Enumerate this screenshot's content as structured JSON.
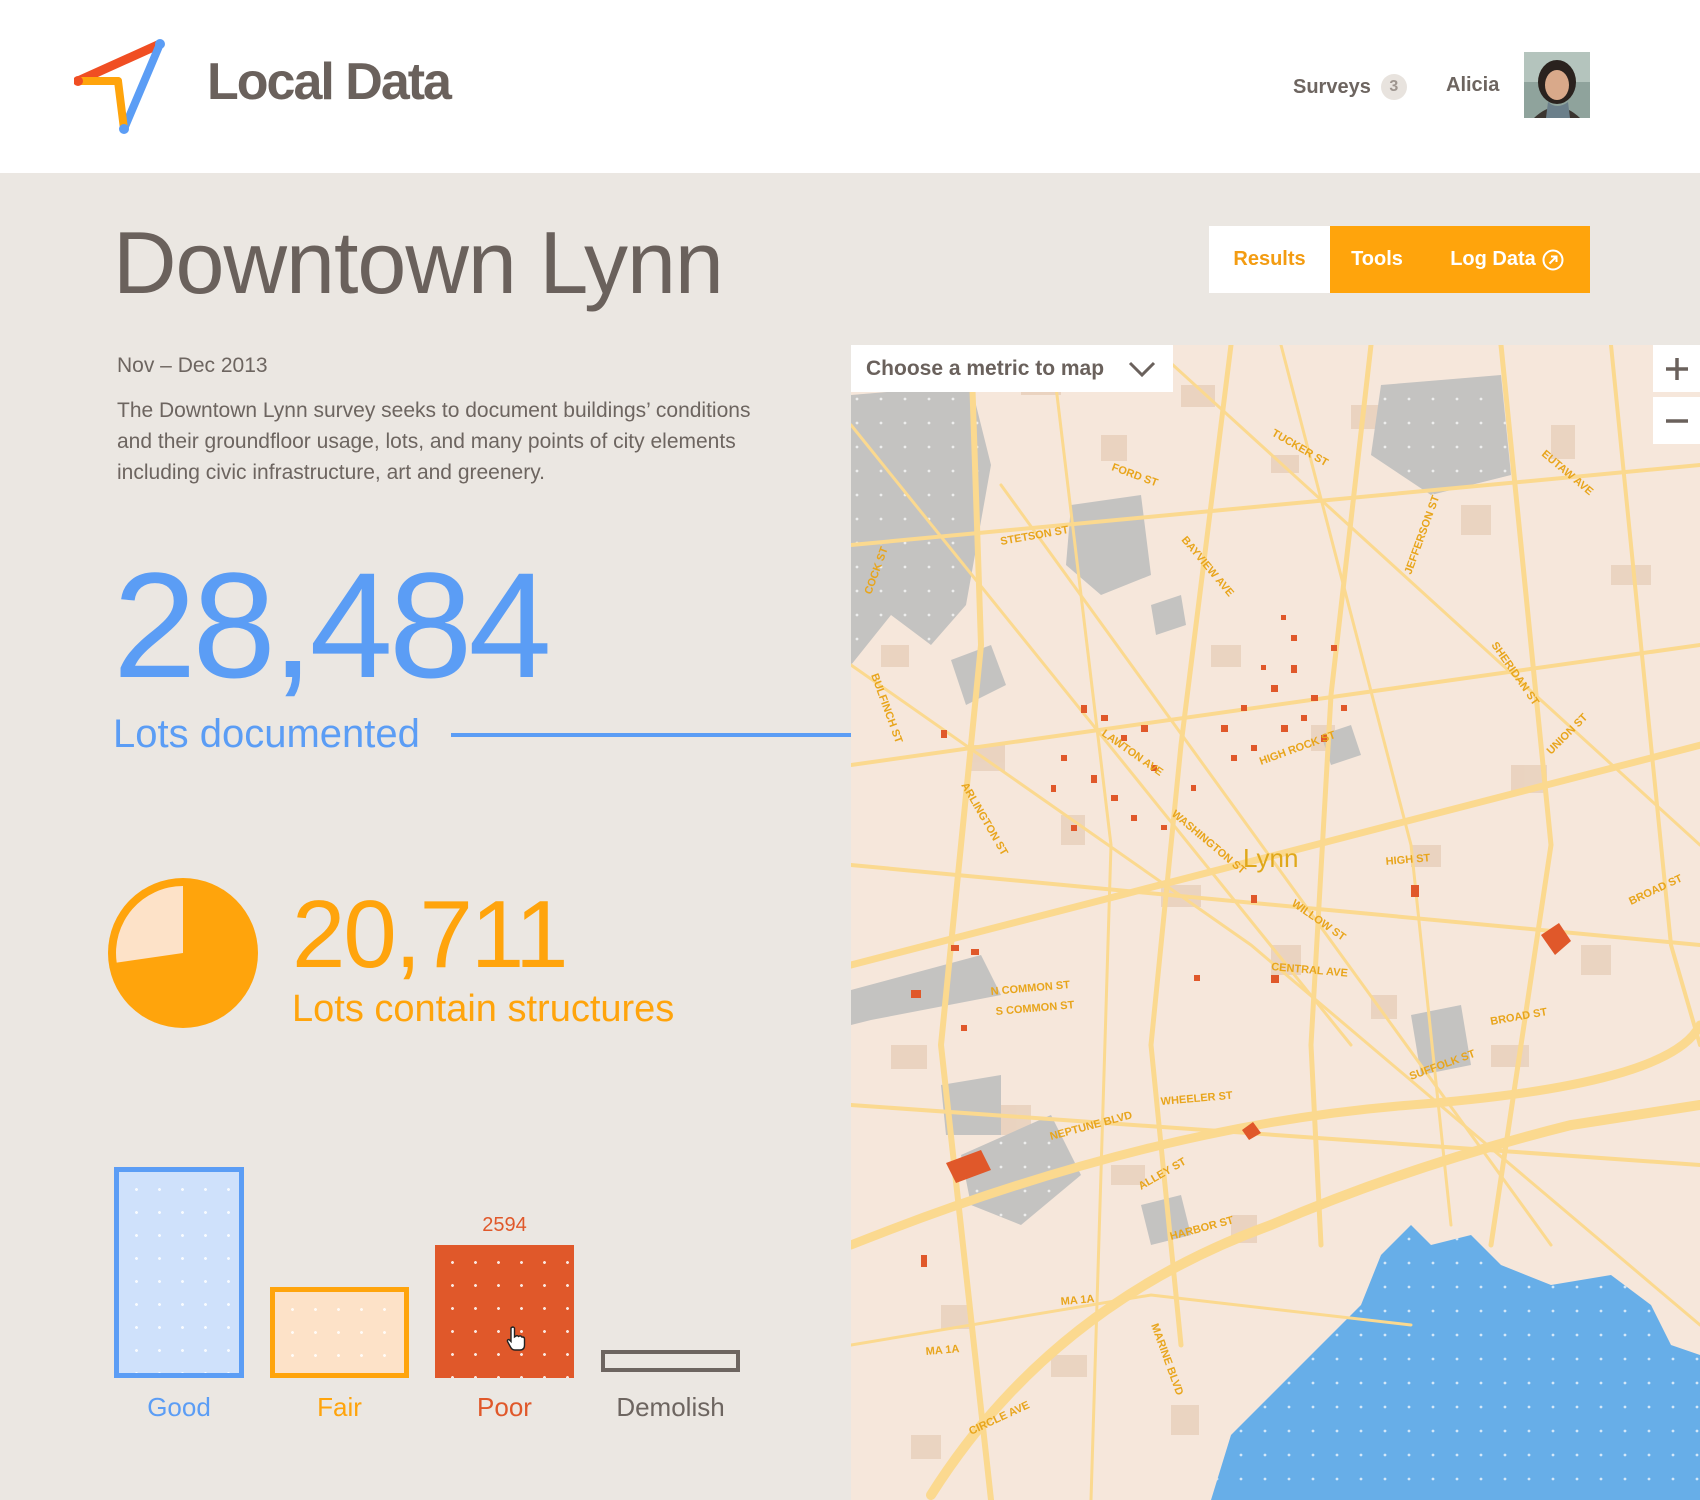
{
  "header": {
    "brand": "Local Data",
    "surveys_label": "Surveys",
    "surveys_count": "3",
    "user_name": "Alicia"
  },
  "page": {
    "title": "Downtown Lynn",
    "date_range": "Nov – Dec 2013",
    "description": "The Downtown Lynn survey seeks to document buildings’ conditions and their groundfloor usage, lots, and many points of city elements including civic infrastructure, art and greenery."
  },
  "tabs": {
    "results": "Results",
    "tools": "Tools",
    "log_data": "Log Data"
  },
  "stats": {
    "lots_documented_value": "28,484",
    "lots_documented_label": "Lots documented",
    "lots_structures_value": "20,711",
    "lots_structures_label": "Lots contain structures",
    "structures_fraction": 0.727
  },
  "conditions": [
    {
      "label": "Good",
      "color": "#5b9df5",
      "fill": "#cfe1fb"
    },
    {
      "label": "Fair",
      "color": "#ffa40c",
      "fill": "#fde2c8"
    },
    {
      "label": "Poor",
      "color": "#e0582a",
      "fill": "#e0582a",
      "value": "2594"
    },
    {
      "label": "Demolish",
      "color": "#6d6560",
      "fill": "#ebe7e2"
    }
  ],
  "map": {
    "metric_placeholder": "Choose a metric to map",
    "city_label": "Lynn",
    "zoom_in": "+",
    "zoom_out": "−"
  },
  "colors": {
    "blue": "#5b9df5",
    "orange": "#ffa40c",
    "red": "#e0582a",
    "water": "#67aee8"
  }
}
